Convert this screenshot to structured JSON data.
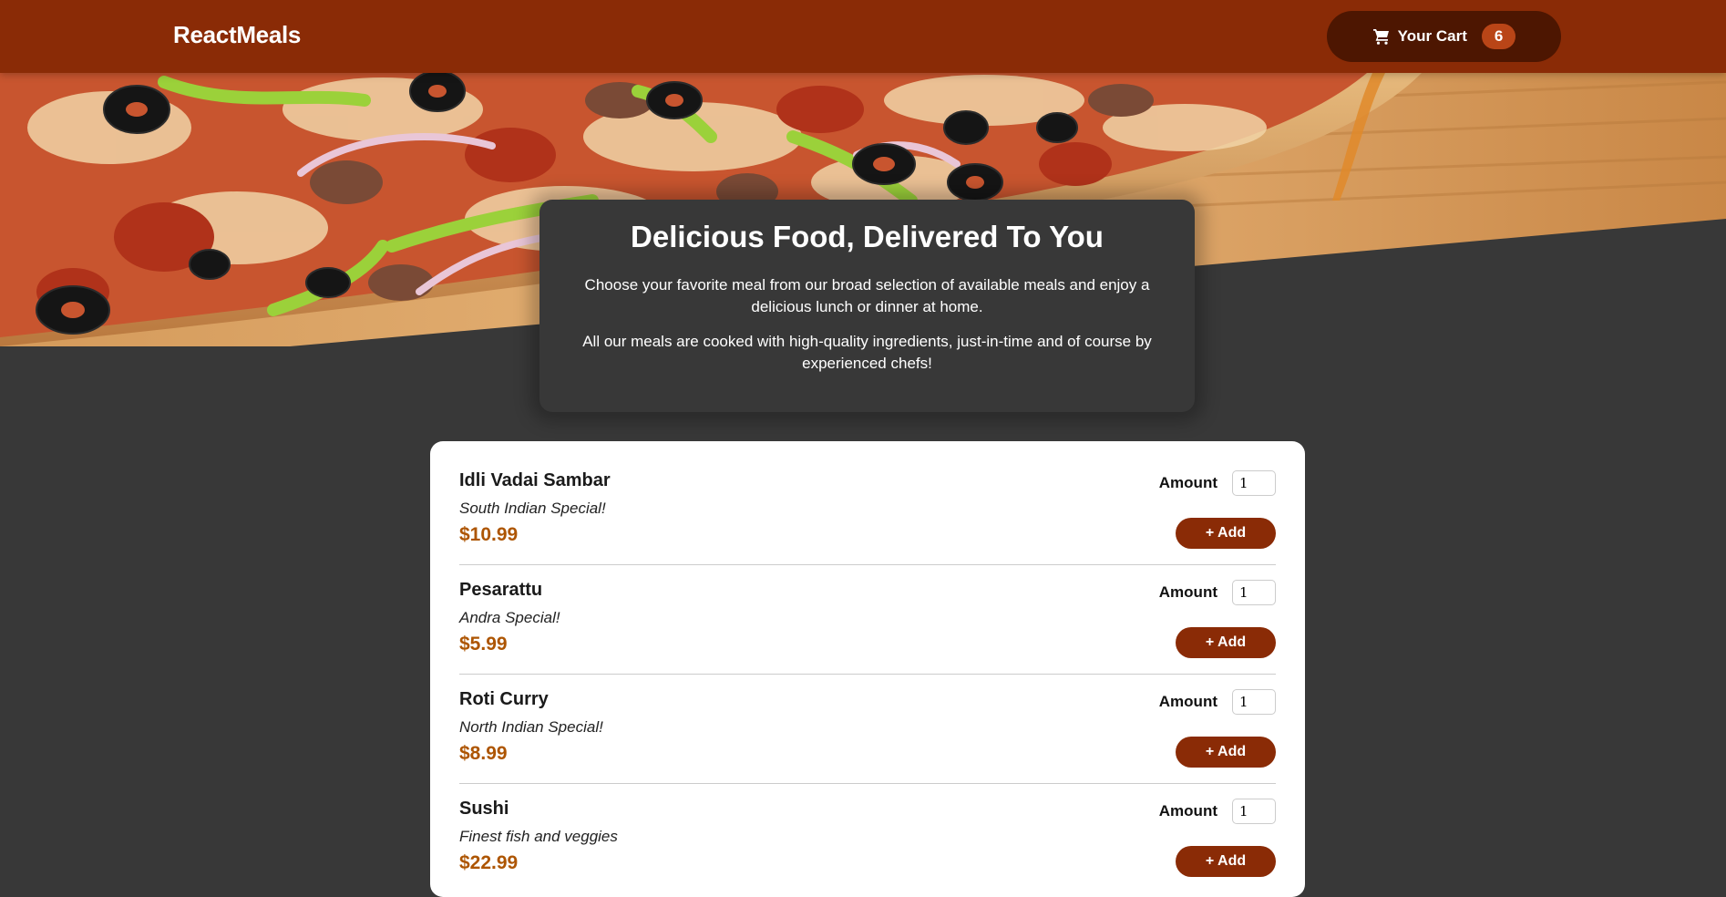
{
  "header": {
    "brand": "ReactMeals",
    "cart": {
      "label": "Your Cart",
      "count": "6",
      "icon": "cart-icon"
    }
  },
  "summary": {
    "title": "Delicious Food, Delivered To You",
    "paragraph1": "Choose your favorite meal from our broad selection of available meals and enjoy a delicious lunch or dinner at home.",
    "paragraph2": "All our meals are cooked with high-quality ingredients, just-in-time and of course by experienced chefs!"
  },
  "meals": [
    {
      "name": "Idli Vadai Sambar",
      "description": "South Indian Special!",
      "price": "$10.99",
      "amount_label": "Amount",
      "amount": "1",
      "add_label": "+ Add"
    },
    {
      "name": "Pesarattu",
      "description": "Andra Special!",
      "price": "$5.99",
      "amount_label": "Amount",
      "amount": "1",
      "add_label": "+ Add"
    },
    {
      "name": "Roti Curry",
      "description": "North Indian Special!",
      "price": "$8.99",
      "amount_label": "Amount",
      "amount": "1",
      "add_label": "+ Add"
    },
    {
      "name": "Sushi",
      "description": "Finest fish and veggies",
      "price": "$22.99",
      "amount_label": "Amount",
      "amount": "1",
      "add_label": "+ Add"
    }
  ],
  "colors": {
    "header_bg": "#8a2b06",
    "cart_bg": "#4d1601",
    "badge_bg": "#b94517",
    "page_bg": "#383838",
    "price": "#ad5502",
    "add_button": "#8a2b06"
  }
}
